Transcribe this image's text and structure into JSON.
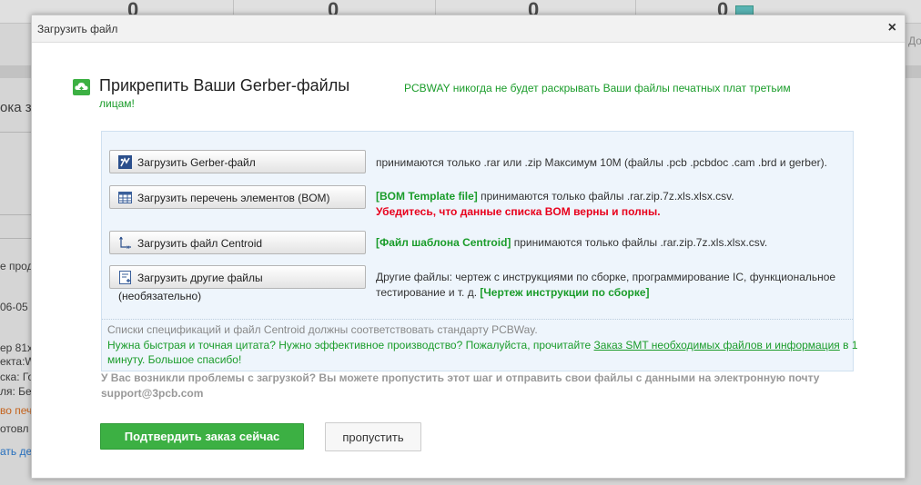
{
  "background": {
    "counters": [
      "0",
      "0",
      "0",
      "0"
    ],
    "right_fragment": "До",
    "left_fragments": [
      "ока з",
      "е прод",
      "06-05",
      "ер 81х",
      "екта:W4",
      "ска: Го",
      "ля: Бел",
      "во печ",
      "отовл",
      "ать дет"
    ]
  },
  "dialog": {
    "title": "Загрузить файл",
    "close_glyph": "×",
    "header_title": "Прикрепить Ваши Gerber-файлы",
    "header_note_line1": "PCBWAY никогда не будет раскрывать Ваши файлы печатных плат третьим",
    "header_note_line2": "лицам!",
    "upload_rows": [
      {
        "button": "Загрузить Gerber-файл",
        "icon": "gerber-icon",
        "desc": "принимаются только .rar или .zip Максимум 10M (файлы .pcb .pcbdoc .cam .brd и gerber)."
      },
      {
        "button": "Загрузить перечень элементов (BOM)",
        "icon": "table-icon",
        "desc_link": "[BOM Template file]",
        "desc": " принимаются только файлы .rar.zip.7z.xls.xlsx.csv.",
        "desc_warning": "Убедитесь, что данные списка BOM верны и полны."
      },
      {
        "button": "Загрузить файл Centroid",
        "icon": "axis-icon",
        "desc_link": "[Файл шаблона Centroid]",
        "desc": " принимаются только файлы .rar.zip.7z.xls.xlsx.csv."
      },
      {
        "button": "Загрузить другие файлы",
        "button_line2": "(необязательно)",
        "icon": "file-plus-icon",
        "desc": "Другие файлы: чертеж с инструкциями по сборке, программирование IC, функциональное",
        "desc_line2": "тестирование и т. д. ",
        "desc_link": "[Чертеж инструкции по сборке]"
      }
    ],
    "footer_gray": "Списки спецификаций и файл Centroid должны соответствовать стандарту PCBWay.",
    "footer_green_before": "Нужна быстрая и точная цитата? Нужно эффективное производство? Пожалуйста, прочитайте ",
    "footer_green_link": "Заказ SMT необходимых файлов и информация",
    "footer_green_after": " в 1",
    "footer_green_line2": "минуту. Большое спасибо!",
    "trouble_line1": "У Вас возникли проблемы с загрузкой? Вы можете пропустить этот шаг и отправить свои файлы с данными на электронную почту",
    "trouble_email": "support@3pcb.com",
    "confirm_button": "Подтвердить заказ сейчас",
    "skip_button": "пропустить"
  },
  "colors": {
    "accent_green": "#3cb043",
    "note_green": "#1a9c2a",
    "warning_red": "#e8001c",
    "panel_bg": "#eef5fc"
  }
}
